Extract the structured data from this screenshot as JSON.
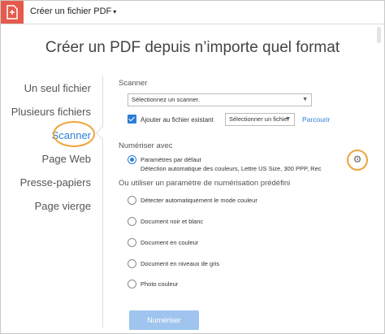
{
  "app": {
    "title": "Créer un fichier PDF",
    "caret": "▾"
  },
  "heading": "Créer un PDF depuis n’importe quel format",
  "nav": {
    "items": [
      {
        "label": "Un seul fichier"
      },
      {
        "label": "Plusieurs fichiers"
      },
      {
        "label": "Scanner"
      },
      {
        "label": "Page Web"
      },
      {
        "label": "Presse-papiers"
      },
      {
        "label": "Page vierge"
      }
    ],
    "active_index": 2
  },
  "scanner": {
    "section_label": "Scanner",
    "select_value": "Sélectionnez un scanner.",
    "add_to_existing": {
      "checked": true,
      "label": "Ajouter au fichier existant"
    },
    "file_select_value": "Sélectionner un fichier",
    "browse_link": "Parcourir"
  },
  "scan_with": {
    "section_label": "Numériser avec",
    "default": {
      "label": "Paramètres par défaut",
      "description": "Détection automatique des couleurs, Lettre US Size, 300 PPP, Rec",
      "selected": true
    },
    "preset_label": "Ou utiliser un paramètre de numérisation prédéfini",
    "presets": [
      {
        "label": "Détecter automatiquement le mode couleur"
      },
      {
        "label": "Document noir et blanc"
      },
      {
        "label": "Document en couleur"
      },
      {
        "label": "Document en niveaux de gris"
      },
      {
        "label": "Photo couleur"
      }
    ]
  },
  "scan_button": "Numériser",
  "icons": {
    "app": "pdf-create-icon",
    "settings": "gear-icon"
  },
  "colors": {
    "accent": "#2d7ed6",
    "highlight": "#f0a43a",
    "app_icon_bg": "#e45a4c",
    "button_disabled": "#9fc5ee"
  }
}
